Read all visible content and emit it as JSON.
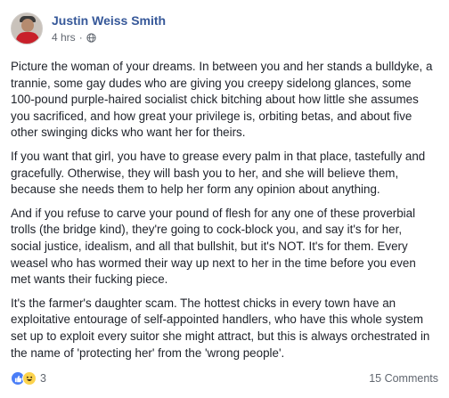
{
  "post": {
    "author": "Justin Weiss Smith",
    "time": "4 hrs",
    "separator": "·",
    "privacy_icon": "globe-icon",
    "paragraphs": [
      "Picture the woman of your dreams. In between you and her stands a bulldyke, a trannie, some gay dudes who are giving you creepy sidelong glances, some 100-pound purple-haired socialist chick bitching about how little she assumes you sacrificed, and how great your privilege is, orbiting betas, and about five other swinging dicks who want her for theirs.",
      "If you want that girl, you have to grease every palm in that place, tastefully and gracefully. Otherwise, they will bash you to her, and she will believe them, because she needs them to help her form any opinion about anything.",
      "And if you refuse to carve your pound of flesh for any one of these proverbial trolls (the bridge kind), they're going to cock-block you, and say it's for her, social justice, idealism, and all that bullshit, but it's NOT. It's for them. Every weasel who has wormed their way up next to her in the time before you even met wants their fucking piece.",
      "It's the farmer's daughter scam. The hottest chicks in every town have an exploitative entourage of self-appointed handlers, who have this whole system set up to exploit every suitor she might attract, but this is always orchestrated in the name of 'protecting her' from the 'wrong people'."
    ]
  },
  "footer": {
    "reaction_icons": [
      "like-icon",
      "haha-icon"
    ],
    "reaction_count": "3",
    "comments": "15 Comments"
  },
  "colors": {
    "author": "#365899",
    "meta": "#616770",
    "like": "#4a7ef7",
    "haha": "#fcd34d"
  }
}
